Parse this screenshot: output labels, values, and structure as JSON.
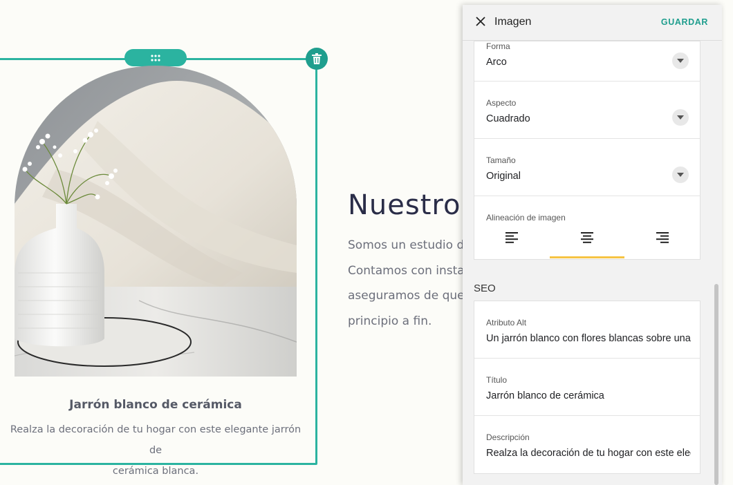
{
  "canvas": {
    "caption_title": "Jarrón blanco de cerámica",
    "caption_description_lines": [
      "Realza la decoración de tu hogar con este elegante jarrón de",
      "cerámica blanca."
    ],
    "section_heading": "Nuestro",
    "section_body_lines": [
      "Somos un estudio de",
      "Contamos con instal",
      "aseguramos de que s",
      "principio a fin."
    ],
    "icons": {
      "drag": "drag-dots-icon",
      "delete": "trash-icon"
    }
  },
  "panel": {
    "title": "Imagen",
    "save_label": "GUARDAR",
    "fields": {
      "shape": {
        "label": "Forma",
        "value": "Arco"
      },
      "aspect": {
        "label": "Aspecto",
        "value": "Cuadrado"
      },
      "size": {
        "label": "Tamaño",
        "value": "Original"
      },
      "alignment": {
        "label": "Alineación de imagen",
        "selected": "center",
        "options": [
          "left",
          "center",
          "right"
        ]
      }
    },
    "seo": {
      "heading": "SEO",
      "alt": {
        "label": "Atributo Alt",
        "value": "Un jarrón blanco con flores blancas sobre una mesa de mármol"
      },
      "title": {
        "label": "Título",
        "value": "Jarrón blanco de cerámica"
      },
      "description": {
        "label": "Descripción",
        "value": "Realza la decoración de tu hogar con este elegante jarrón de cerámica blanca."
      }
    }
  },
  "colors": {
    "accent": "#2bb3a0",
    "alignment_indicator": "#f6c343",
    "heading": "#2a2d48",
    "body_text": "#6c6f7b"
  }
}
